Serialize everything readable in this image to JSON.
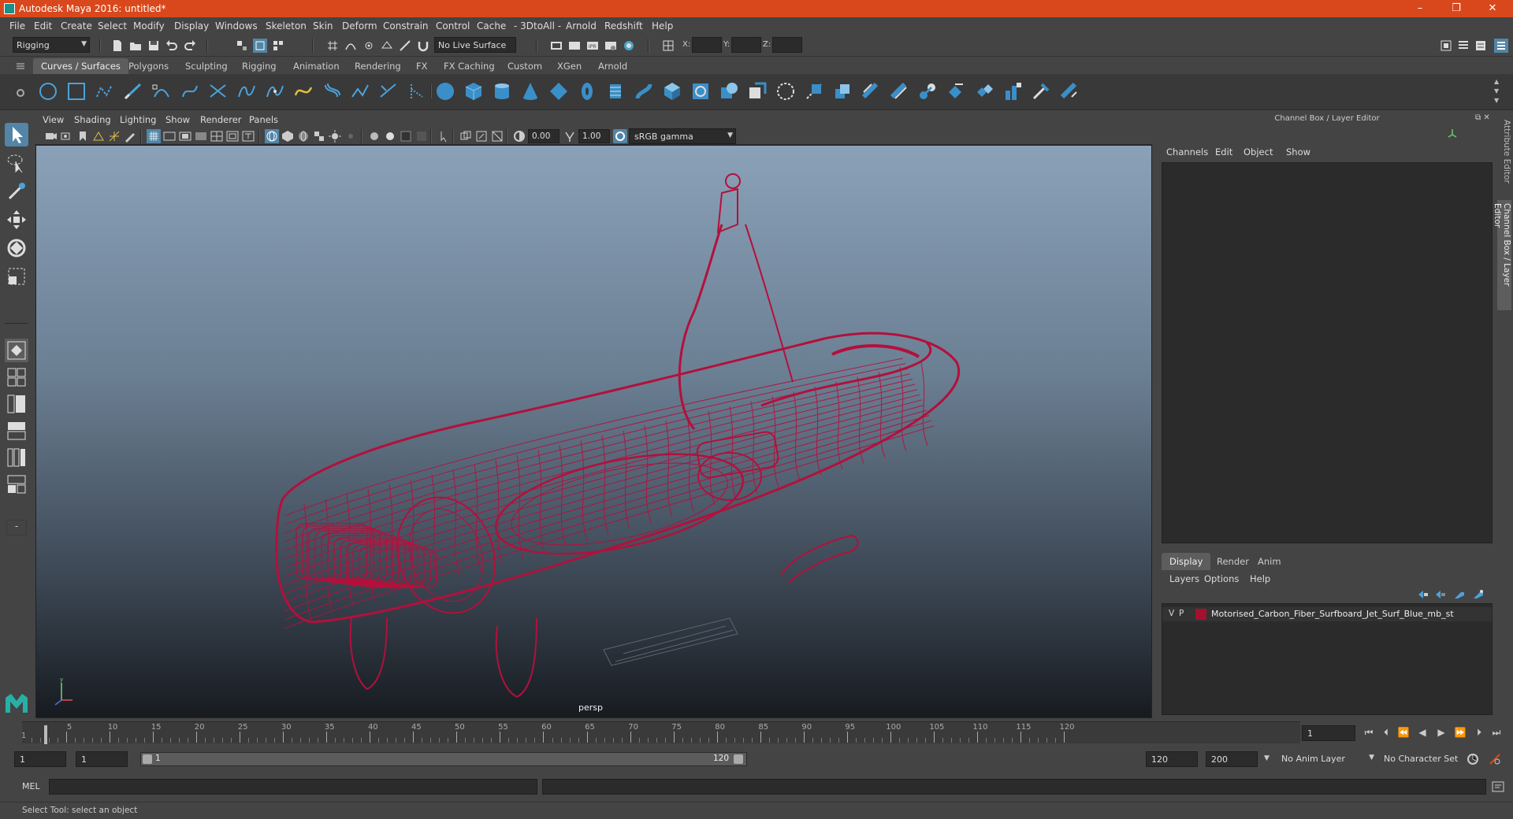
{
  "window": {
    "title": "Autodesk Maya 2016: untitled*",
    "minimize": "–",
    "maximize": "❐",
    "close": "✕"
  },
  "menubar": [
    "File",
    "Edit",
    "Create",
    "Select",
    "Modify",
    "Display",
    "Windows",
    "Skeleton",
    "Skin",
    "Deform",
    "Constrain",
    "Control",
    "Cache",
    "- 3DtoAll -",
    "Arnold",
    "Redshift",
    "Help"
  ],
  "statusline": {
    "menuset": "Rigging",
    "live_surface": "No Live Surface",
    "x_label": "X:",
    "y_label": "Y:",
    "z_label": "Z:"
  },
  "shelf_tabs": [
    "Curves / Surfaces",
    "Polygons",
    "Sculpting",
    "Rigging",
    "Animation",
    "Rendering",
    "FX",
    "FX Caching",
    "Custom",
    "XGen",
    "Arnold"
  ],
  "shelf_active": "Curves / Surfaces",
  "viewport": {
    "menu": [
      "View",
      "Shading",
      "Lighting",
      "Show",
      "Renderer",
      "Panels"
    ],
    "exposure": "0.00",
    "gamma": "1.00",
    "colorspace": "sRGB gamma",
    "camera": "persp",
    "model_color": "#b3103c"
  },
  "channel_box": {
    "title": "Channel Box / Layer Editor",
    "menu": [
      "Channels",
      "Edit",
      "Object",
      "Show"
    ]
  },
  "layer_editor": {
    "tabs": [
      "Display",
      "Render",
      "Anim"
    ],
    "active_tab": "Display",
    "menu": [
      "Layers",
      "Options",
      "Help"
    ],
    "layer": {
      "v": "V",
      "p": "P",
      "name": "Motorised_Carbon_Fiber_Surfboard_Jet_Surf_Blue_mb_st",
      "color": "#a3112f"
    }
  },
  "side_tabs": [
    "Attribute Editor",
    "Channel Box / Layer Editor"
  ],
  "timeline": {
    "labels": [
      "5",
      "10",
      "15",
      "20",
      "25",
      "30",
      "35",
      "40",
      "45",
      "50",
      "55",
      "60",
      "65",
      "70",
      "75",
      "80",
      "85",
      "90",
      "95",
      "100",
      "105",
      "110",
      "115",
      "120"
    ],
    "start_label": "1",
    "current_frame": "1"
  },
  "range": {
    "start": "1",
    "playback_start": "1",
    "slider_start": "1",
    "slider_end": "120",
    "playback_end": "120",
    "end": "200",
    "anim_layer": "No Anim Layer",
    "character_set": "No Character Set"
  },
  "cmdline": {
    "label": "MEL"
  },
  "helpline": "Select Tool: select an object"
}
